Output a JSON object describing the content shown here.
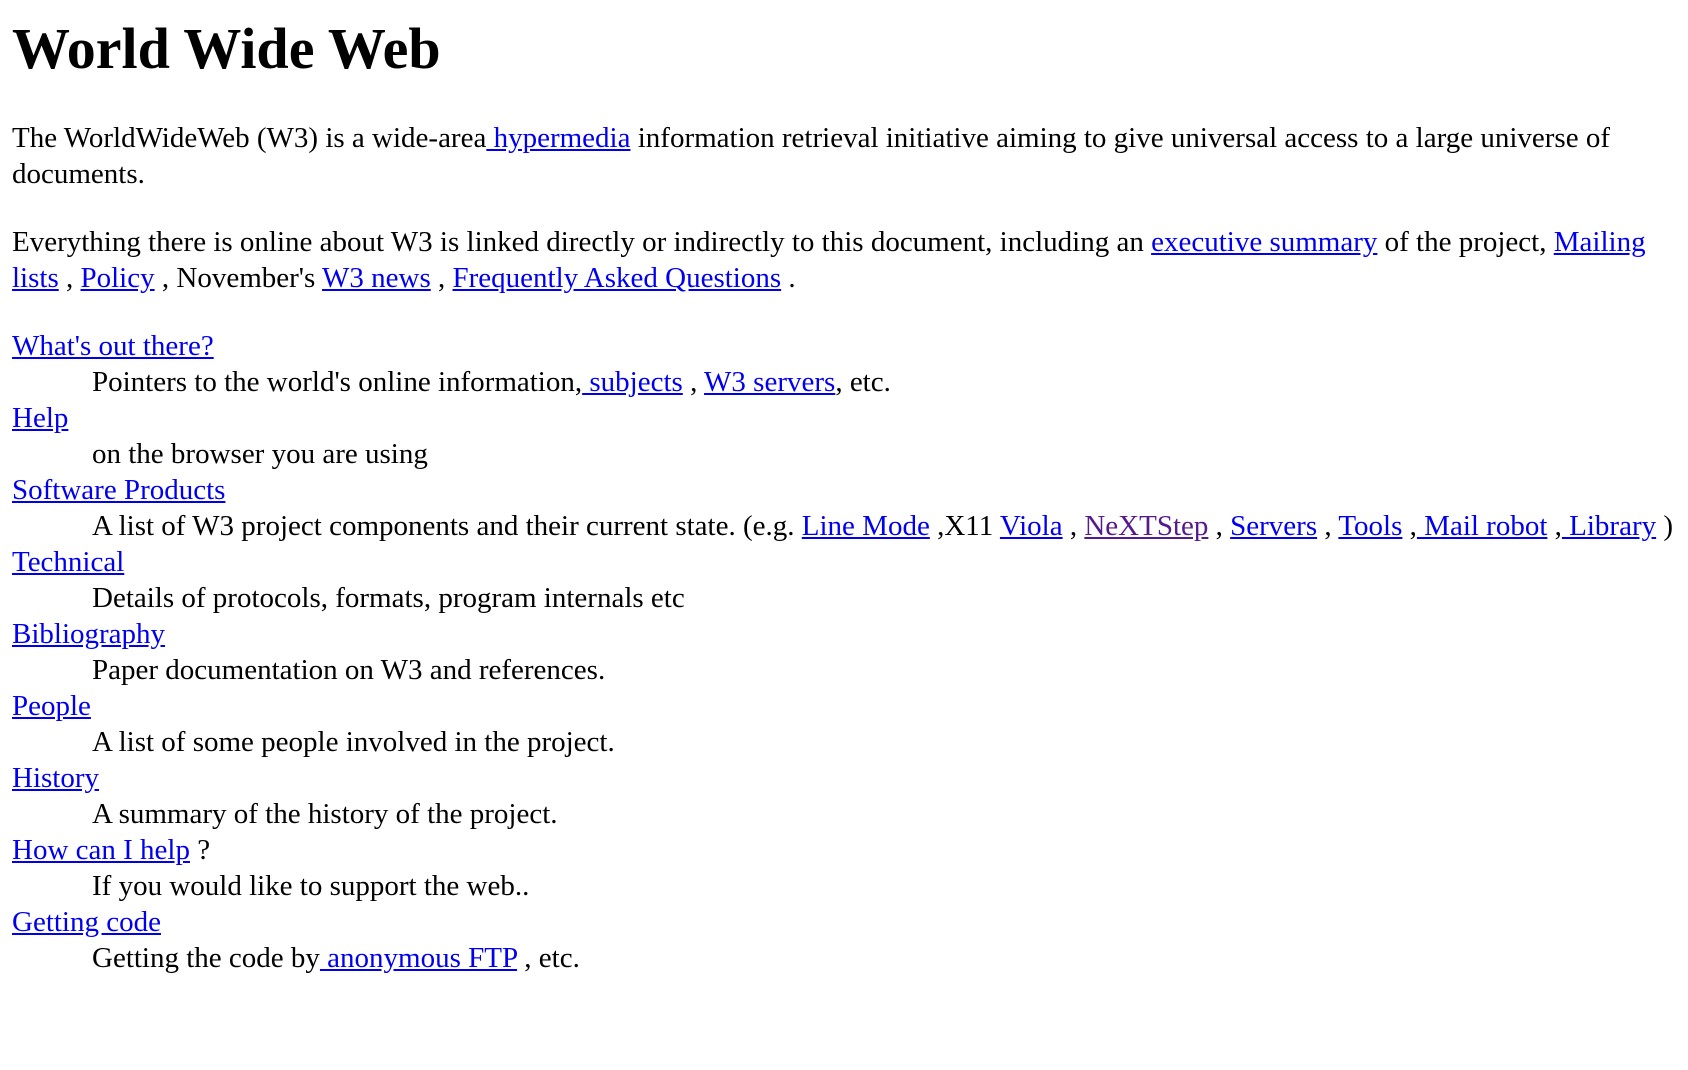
{
  "title": "World Wide Web",
  "intro": {
    "t1": "The WorldWideWeb (W3) is a wide-area",
    "link_hypermedia": " hypermedia",
    "t2": " information retrieval initiative aiming to give universal access to a large universe of documents."
  },
  "summary": {
    "t1": "Everything there is online about W3 is linked directly or indirectly to this document, including an ",
    "link_exec": "executive summary",
    "t2": " of the project, ",
    "link_mailing": "Mailing lists",
    "t3": " , ",
    "link_policy": "Policy",
    "t4": " , November's ",
    "link_news": "W3 news",
    "t5": " , ",
    "link_faq": "Frequently Asked Questions",
    "t6": " ."
  },
  "items": [
    {
      "term": "What's out there?",
      "d1": "Pointers to the world's online information,",
      "l1": " subjects",
      "d2": " , ",
      "l2": "W3 servers",
      "d3": ", etc."
    },
    {
      "term": "Help",
      "d1": "on the browser you are using"
    },
    {
      "term": "Software Products",
      "d1": "A list of W3 project components and their current state. (e.g. ",
      "l1": "Line Mode",
      "d2": " ,X11 ",
      "l2": "Viola",
      "d3": " , ",
      "l3": "NeXTStep",
      "d4": " , ",
      "l4": "Servers",
      "d5": " , ",
      "l5": "Tools",
      "d6": " ,",
      "l6": " Mail robot",
      "d7": " ,",
      "l7": " Library",
      "d8": " )"
    },
    {
      "term": "Technical",
      "d1": "Details of protocols, formats, program internals etc"
    },
    {
      "term": "Bibliography",
      "d1": "Paper documentation on W3 and references."
    },
    {
      "term": "People",
      "d1": "A list of some people involved in the project."
    },
    {
      "term": "History",
      "d1": "A summary of the history of the project."
    },
    {
      "term": "How can I help",
      "after": " ?",
      "d1": "If you would like to support the web.."
    },
    {
      "term": "Getting code",
      "d1": "Getting the code by",
      "l1": " anonymous FTP",
      "d2": " , etc."
    }
  ],
  "colors": {
    "link": "#0000ee",
    "visited_link": "#551a8b",
    "text": "#000000",
    "background": "#ffffff"
  }
}
